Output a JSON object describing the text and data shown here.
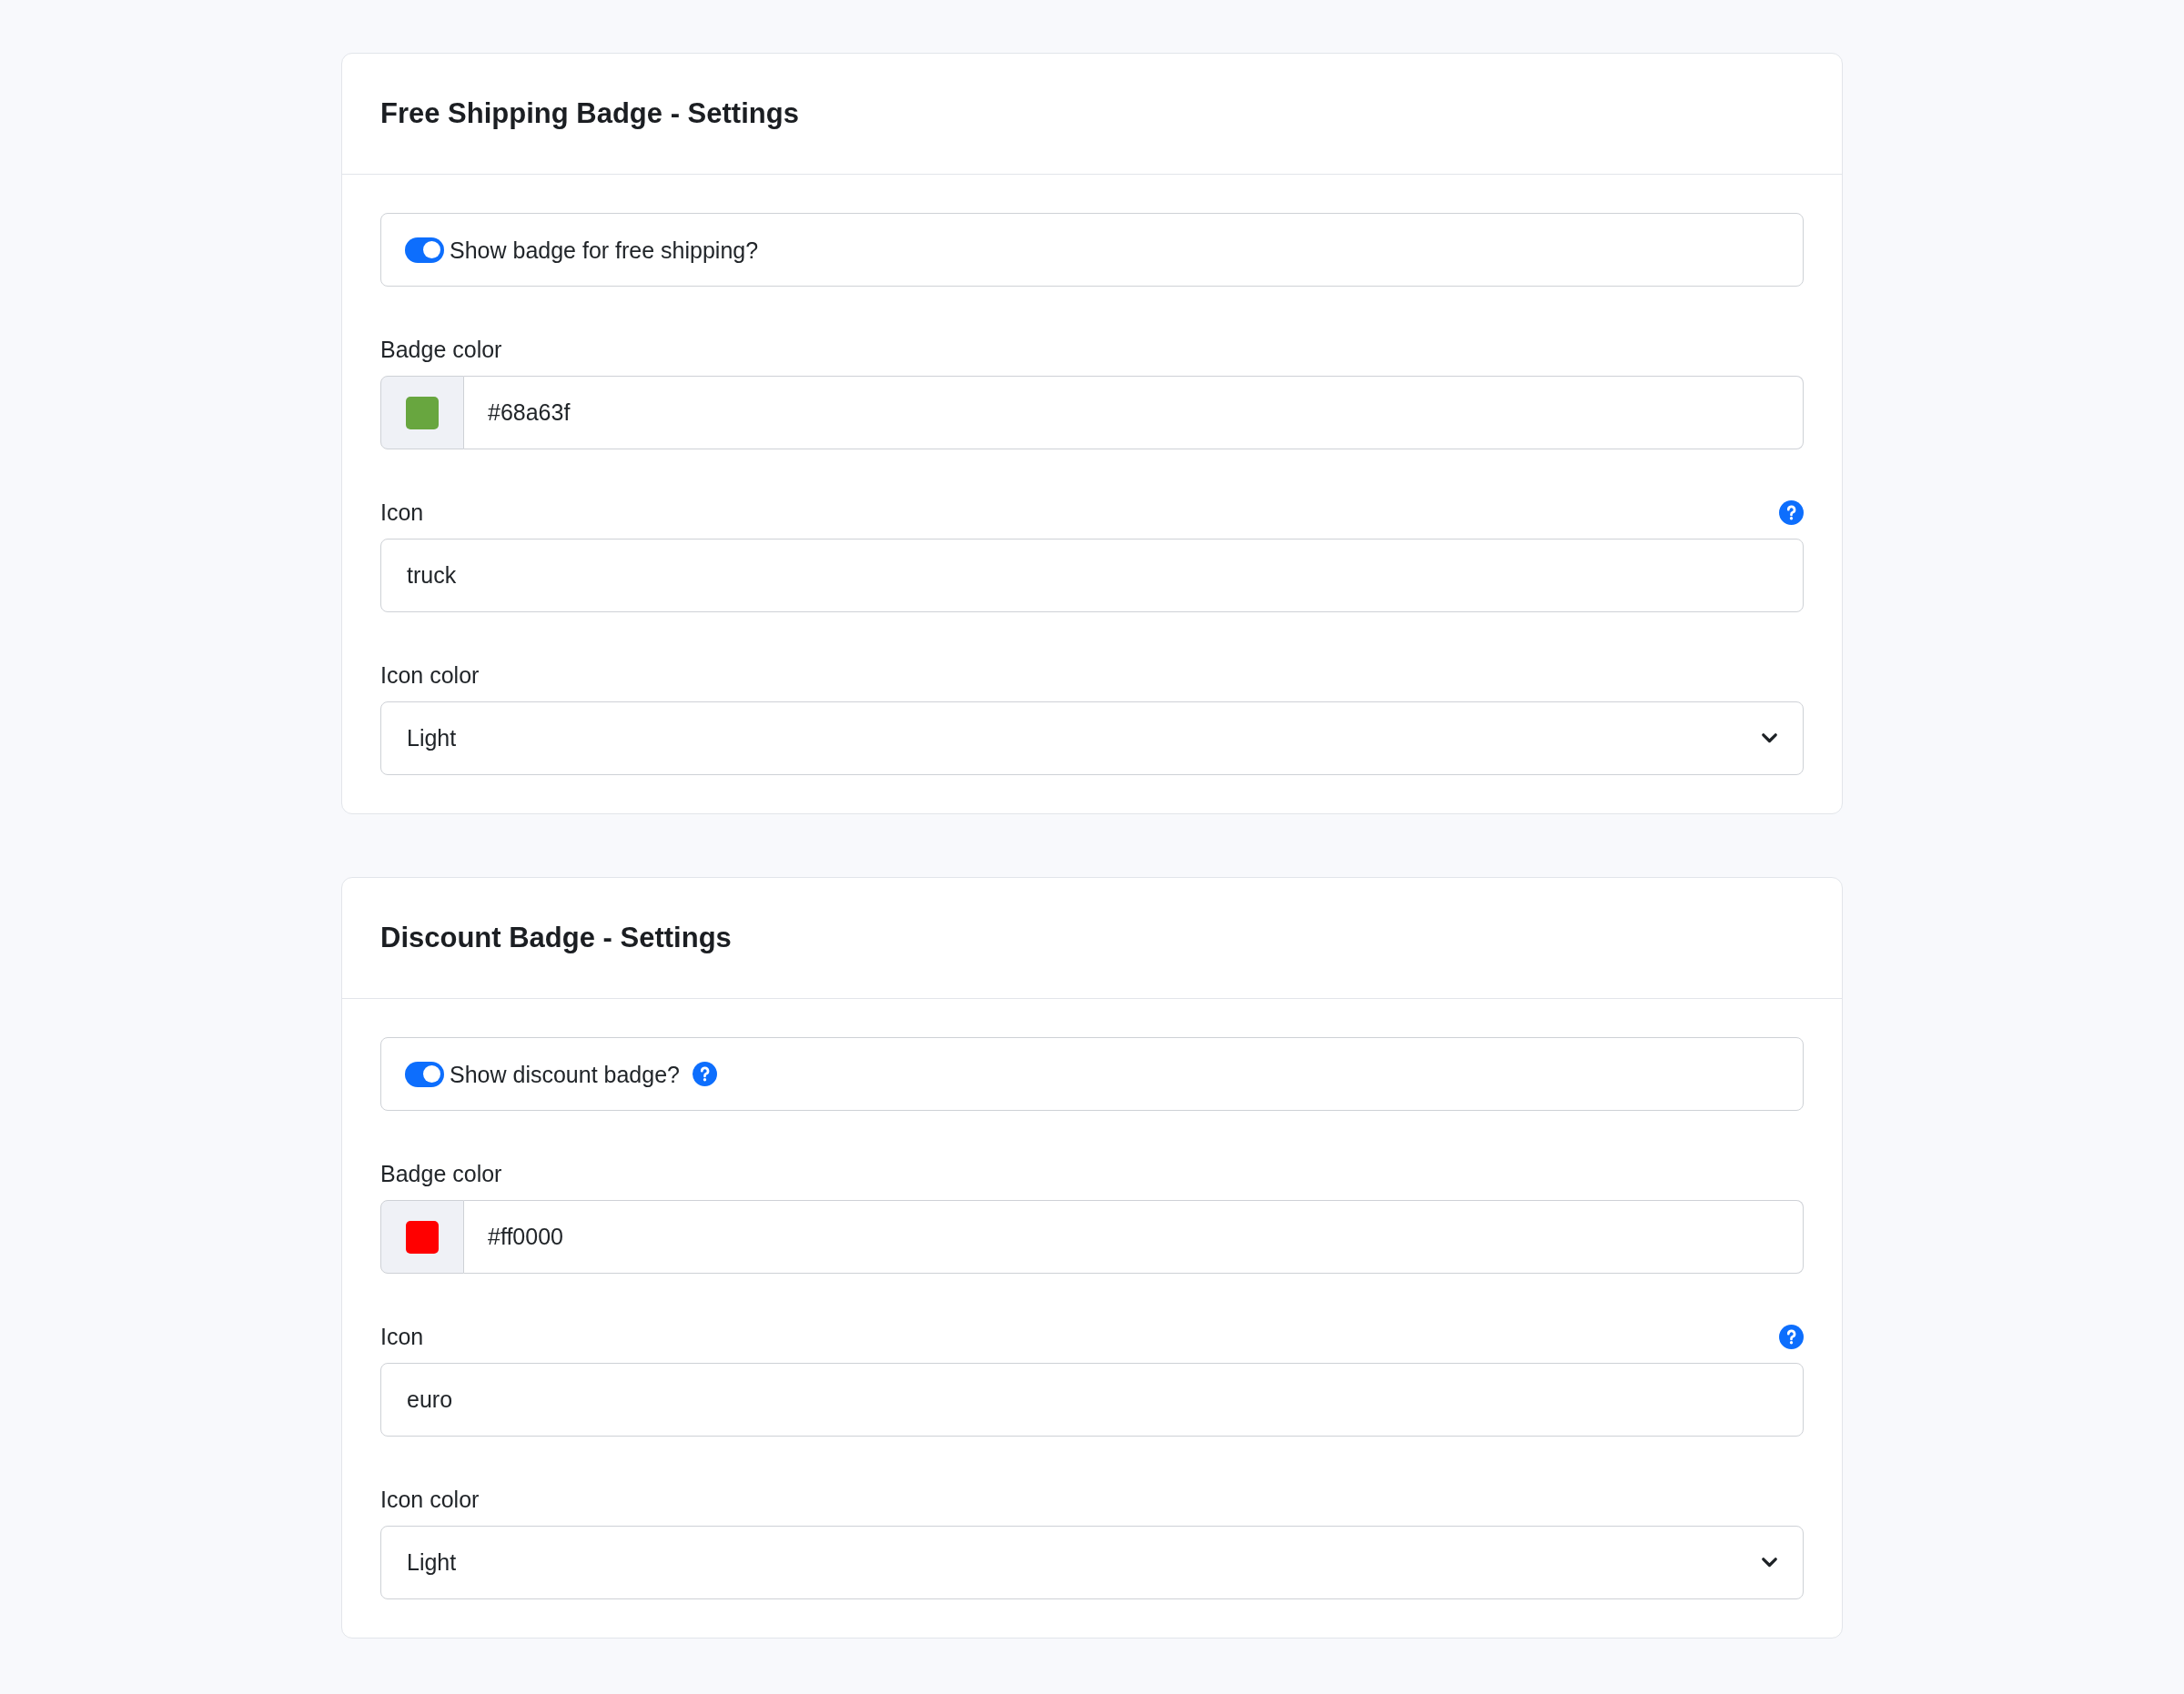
{
  "cards": [
    {
      "title": "Free Shipping Badge - Settings",
      "toggle": {
        "label": "Show badge for free shipping?",
        "on": true,
        "help": false
      },
      "fields": [
        {
          "kind": "color",
          "label": "Badge color",
          "value": "#68a63f",
          "color": "#68a63f",
          "help": false
        },
        {
          "kind": "text",
          "label": "Icon",
          "value": "truck",
          "help": true
        },
        {
          "kind": "select",
          "label": "Icon color",
          "value": "Light",
          "help": false
        }
      ]
    },
    {
      "title": "Discount Badge - Settings",
      "toggle": {
        "label": "Show discount badge?",
        "on": true,
        "help": true
      },
      "fields": [
        {
          "kind": "color",
          "label": "Badge color",
          "value": "#ff0000",
          "color": "#ff0000",
          "help": false
        },
        {
          "kind": "text",
          "label": "Icon",
          "value": "euro",
          "help": true
        },
        {
          "kind": "select",
          "label": "Icon color",
          "value": "Light",
          "help": false
        }
      ]
    }
  ]
}
